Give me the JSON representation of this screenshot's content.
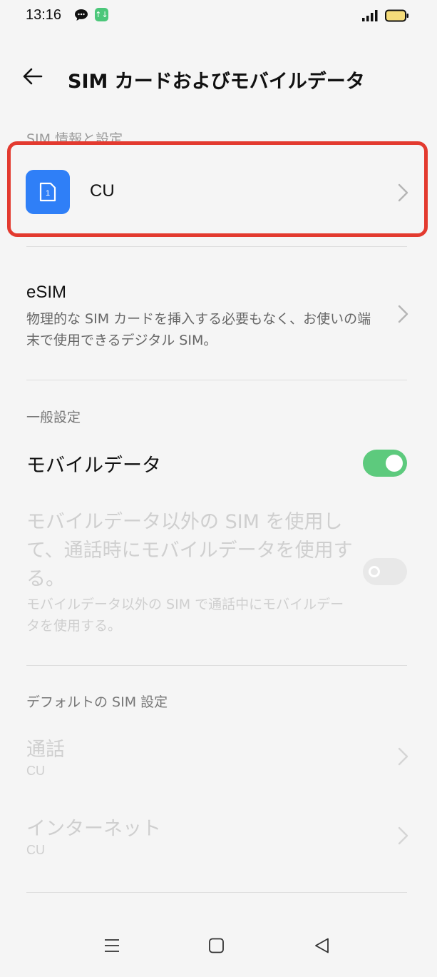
{
  "status_bar": {
    "time": "13:16",
    "app_icon_text": "↑↓"
  },
  "header": {
    "title": "SIM カードおよびモバイルデータ"
  },
  "sim_section": {
    "label": "SIM 情報と設定",
    "sim_slot": "1",
    "sim_name": "CU"
  },
  "esim": {
    "title": "eSIM",
    "description": "物理的な SIM カードを挿入する必要もなく、お使いの端末で使用できるデジタル SIM。"
  },
  "general": {
    "label": "一般設定",
    "mobile_data_label": "モバイルデータ",
    "mobile_data_on": true,
    "call_data_title": "モバイルデータ以外の SIM を使用して、通話時にモバイルデータを使用する。",
    "call_data_desc": "モバイルデータ以外の SIM で通話中にモバイルデータを使用する。",
    "call_data_on": false
  },
  "default_sim": {
    "label": "デフォルトの SIM 設定",
    "call_title": "通話",
    "call_value": "CU",
    "internet_title": "インターネット",
    "internet_value": "CU"
  },
  "colors": {
    "sim_icon": "#2f7ff7",
    "toggle_on": "#5dca7d",
    "highlight": "#e33a2f"
  },
  "icons": [
    "chat-icon",
    "app-notification-icon",
    "signal-icon",
    "battery-icon",
    "back-arrow-icon",
    "sim-card-icon",
    "chevron-right-icon",
    "menu-icon",
    "home-icon",
    "back-triangle-icon"
  ]
}
